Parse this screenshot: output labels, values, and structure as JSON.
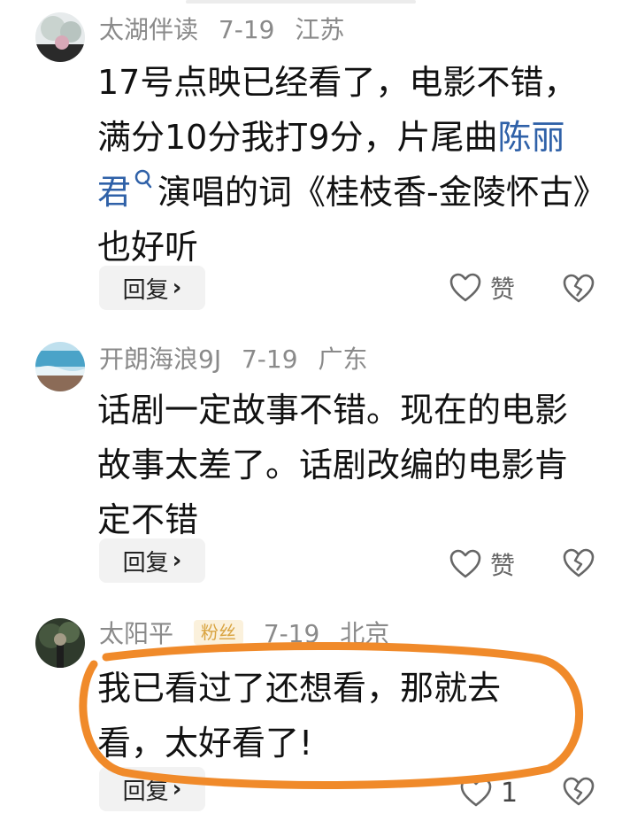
{
  "comments": [
    {
      "user": "太湖伴读",
      "date": "7-19",
      "location": "江苏",
      "text_pre": "17号点映已经看了，电影不错，满分10分我打9分，片尾曲",
      "link": "陈丽君",
      "text_post": "演唱的词《桂枝香-金陵怀古》也好听",
      "reply": "回复",
      "like_label": "赞"
    },
    {
      "user": "开朗海浪9J",
      "date": "7-19",
      "location": "广东",
      "text": "话剧一定故事不错。现在的电影故事太差了。话剧改编的电影肯定不错",
      "reply": "回复",
      "like_label": "赞"
    },
    {
      "user": "太阳平",
      "badge": "粉丝",
      "date": "7-19",
      "location": "北京",
      "text": "我已看过了还想看，那就去看，太好看了!",
      "reply": "回复",
      "like_label": "1"
    }
  ],
  "colors": {
    "meta": "#8a8a8a",
    "link": "#2f61a8",
    "highlight": "#f08a2a",
    "badge_bg": "#fbf1dc",
    "badge_text": "#d9a441"
  },
  "icons": {
    "like": "heart-outline-icon",
    "dislike": "broken-heart-icon",
    "search": "search-icon",
    "reply_chevron": "chevron-right-icon"
  }
}
